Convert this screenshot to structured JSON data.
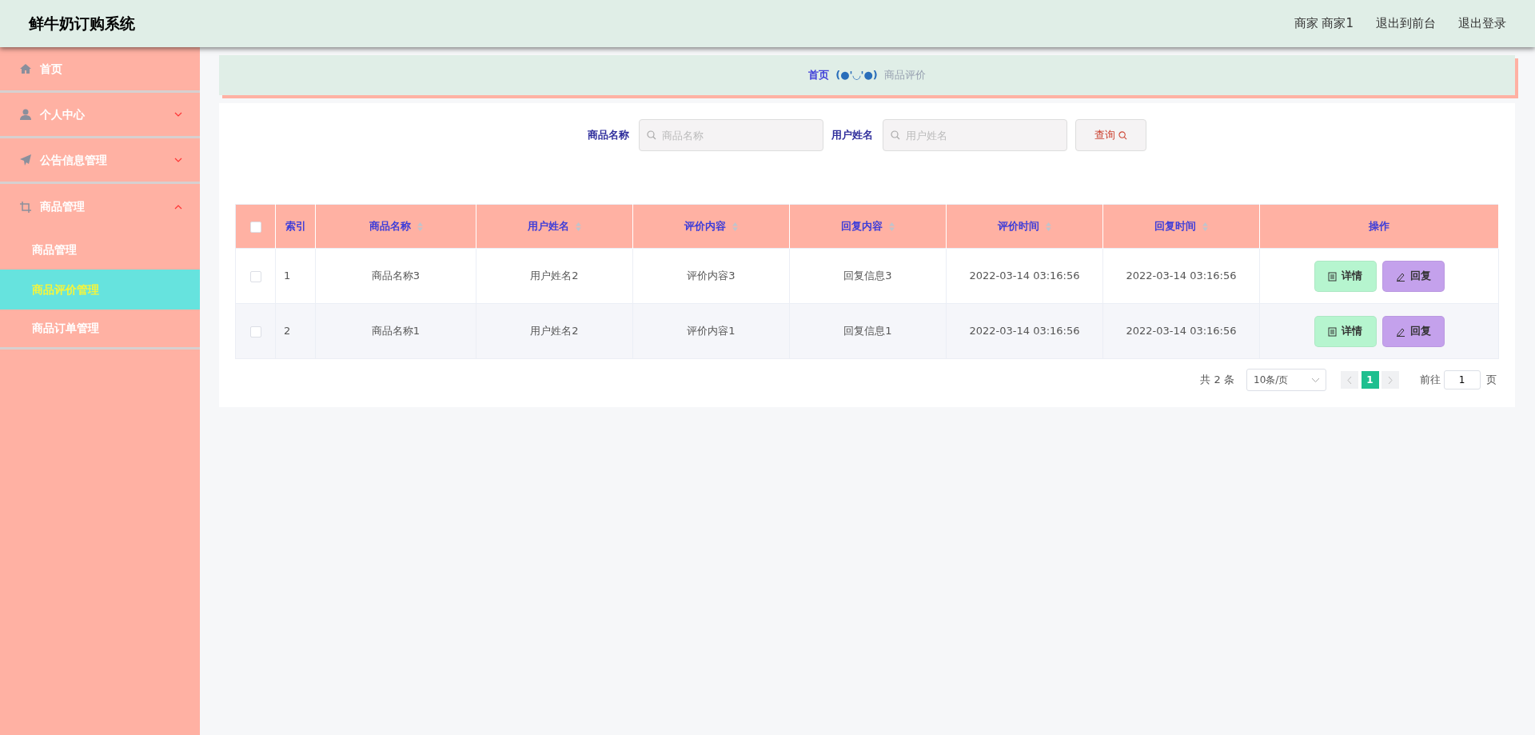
{
  "header": {
    "title": "鲜牛奶订购系统",
    "user": "商家 商家1",
    "links": [
      "退出到前台",
      "退出登录"
    ]
  },
  "sidebar": {
    "items": [
      {
        "label": "首页"
      },
      {
        "label": "个人中心",
        "expanded": false
      },
      {
        "label": "公告信息管理",
        "expanded": false
      },
      {
        "label": "商品管理",
        "expanded": true,
        "children": [
          {
            "label": "商品管理",
            "selected": false
          },
          {
            "label": "商品评价管理",
            "selected": true
          },
          {
            "label": "商品订单管理",
            "selected": false
          }
        ]
      }
    ]
  },
  "breadcrumb": {
    "home": "首页",
    "separator": "(●'◡'●)",
    "current": "商品评价"
  },
  "search": {
    "fields": [
      {
        "label": "商品名称",
        "placeholder": "商品名称"
      },
      {
        "label": "用户姓名",
        "placeholder": "用户姓名"
      }
    ],
    "button": "查询"
  },
  "table": {
    "select_all_checked": false,
    "columns": [
      {
        "label": "索引",
        "sortable": false
      },
      {
        "label": "商品名称",
        "sortable": true
      },
      {
        "label": "用户姓名",
        "sortable": true
      },
      {
        "label": "评价内容",
        "sortable": true
      },
      {
        "label": "回复内容",
        "sortable": true
      },
      {
        "label": "评价时间",
        "sortable": true
      },
      {
        "label": "回复时间",
        "sortable": true
      },
      {
        "label": "操作",
        "sortable": false
      }
    ],
    "rows": [
      {
        "checked": false,
        "cells": [
          "1",
          "商品名称3",
          "用户姓名2",
          "评价内容3",
          "回复信息3",
          "2022-03-14 03:16:56",
          "2022-03-14 03:16:56"
        ],
        "actions": [
          "详情",
          "回复"
        ]
      },
      {
        "checked": false,
        "cells": [
          "2",
          "商品名称1",
          "用户姓名2",
          "评价内容1",
          "回复信息1",
          "2022-03-14 03:16:56",
          "2022-03-14 03:16:56"
        ],
        "actions": [
          "详情",
          "回复"
        ]
      }
    ]
  },
  "pagination": {
    "total": "共 2 条",
    "page_size": "10条/页",
    "pages": [
      {
        "label": "1",
        "selected": true
      }
    ],
    "goto_label": "前往",
    "goto_value": "1",
    "goto_suffix": "页"
  }
}
